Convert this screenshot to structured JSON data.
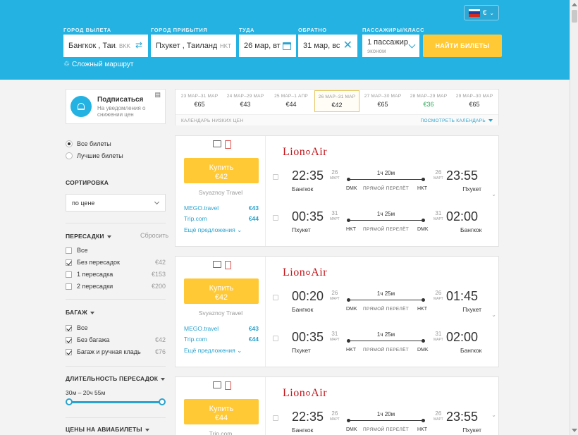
{
  "header": {
    "lang_currency": "€",
    "from_label": "ГОРОД ВЫЛЕТА",
    "from_value": "Бангкок , Таила",
    "from_code": "BKK",
    "to_label": "ГОРОД ПРИБЫТИЯ",
    "to_value": "Пхукет , Таиланд",
    "to_code": "HKT",
    "depart_label": "ТУДА",
    "depart_value": "26 мар, вт",
    "return_label": "ОБРАТНО",
    "return_value": "31 мар, вс",
    "pax_label": "ПАССАЖИРЫ/КЛАСС",
    "pax_value": "1 пассажир",
    "pax_class": "эконом",
    "search_button": "НАЙТИ БИЛЕТЫ",
    "complex_route": "Сложный маршрут"
  },
  "subscribe": {
    "title": "Подписаться",
    "desc": "На уведомления о снижении цен"
  },
  "date_strip": {
    "cells": [
      {
        "range": "23 МАР–31 МАР",
        "price": "€65"
      },
      {
        "range": "24 МАР–29 МАР",
        "price": "€43"
      },
      {
        "range": "25 МАР–1 АПР",
        "price": "€44"
      },
      {
        "range": "26 МАР–31 МАР",
        "price": "€42"
      },
      {
        "range": "27 МАР–30 МАР",
        "price": "€65"
      },
      {
        "range": "28 МАР–29 МАР",
        "price": "€36"
      },
      {
        "range": "29 МАР–30 МАР",
        "price": "€65"
      }
    ],
    "footer_left": "КАЛЕНДАРЬ НИЗКИХ ЦЕН",
    "footer_right": "ПОСМОТРЕТЬ КАЛЕНДАРЬ"
  },
  "filters": {
    "all_tickets": "Все билеты",
    "best_tickets": "Лучшие билеты",
    "sort_title": "СОРТИРОВКА",
    "sort_value": "по цене",
    "stops_title": "ПЕРЕСАДКИ",
    "reset": "Сбросить",
    "stops": [
      {
        "label": "Все",
        "price": ""
      },
      {
        "label": "Без пересадок",
        "price": "€42"
      },
      {
        "label": "1 пересадка",
        "price": "€153"
      },
      {
        "label": "2 пересадки",
        "price": "€200"
      }
    ],
    "baggage_title": "БАГАЖ",
    "baggage": [
      {
        "label": "Все",
        "price": ""
      },
      {
        "label": "Без багажа",
        "price": "€42"
      },
      {
        "label": "Багаж и ручная кладь",
        "price": "€76"
      }
    ],
    "duration_title": "ДЛИТЕЛЬНОСТЬ ПЕРЕСАДОК",
    "duration_range": "30м – 20ч 55м",
    "prices_title": "ЦЕНЫ НА АВИАБИЛЕТЫ"
  },
  "tickets": [
    {
      "buy": "Купить",
      "price": "€42",
      "agency": "Svyaznoy Travel",
      "offers": [
        {
          "name": "MEGO.travel",
          "price": "€43"
        },
        {
          "name": "Trip.com",
          "price": "€44"
        }
      ],
      "more": "Ещё предложения",
      "airline_a": "Lion",
      "airline_b": "Air",
      "segments": [
        {
          "dep_time": "22:35",
          "dep_day": "26",
          "dep_mon": "МАРТ",
          "dep_city": "Бангкок",
          "dep_code": "DMK",
          "duration": "1ч 20м",
          "direct": "ПРЯМОЙ ПЕРЕЛЁТ",
          "arr_code": "HKT",
          "arr_day": "26",
          "arr_mon": "МАРТ",
          "arr_time": "23:55",
          "arr_city": "Пхукет"
        },
        {
          "dep_time": "00:35",
          "dep_day": "31",
          "dep_mon": "МАРТ",
          "dep_city": "Пхукет",
          "dep_code": "HKT",
          "duration": "1ч 25м",
          "direct": "ПРЯМОЙ ПЕРЕЛЁТ",
          "arr_code": "DMK",
          "arr_day": "31",
          "arr_mon": "МАРТ",
          "arr_time": "02:00",
          "arr_city": "Бангкок"
        }
      ]
    },
    {
      "buy": "Купить",
      "price": "€42",
      "agency": "Svyaznoy Travel",
      "offers": [
        {
          "name": "MEGO.travel",
          "price": "€43"
        },
        {
          "name": "Trip.com",
          "price": "€44"
        }
      ],
      "more": "Ещё предложения",
      "airline_a": "Lion",
      "airline_b": "Air",
      "segments": [
        {
          "dep_time": "00:20",
          "dep_day": "26",
          "dep_mon": "МАРТ",
          "dep_city": "Бангкок",
          "dep_code": "DMK",
          "duration": "1ч 25м",
          "direct": "ПРЯМОЙ ПЕРЕЛЁТ",
          "arr_code": "HKT",
          "arr_day": "26",
          "arr_mon": "МАРТ",
          "arr_time": "01:45",
          "arr_city": "Пхукет"
        },
        {
          "dep_time": "00:35",
          "dep_day": "31",
          "dep_mon": "МАРТ",
          "dep_city": "Пхукет",
          "dep_code": "HKT",
          "duration": "1ч 25м",
          "direct": "ПРЯМОЙ ПЕРЕЛЁТ",
          "arr_code": "DMK",
          "arr_day": "31",
          "arr_mon": "МАРТ",
          "arr_time": "02:00",
          "arr_city": "Бангкок"
        }
      ]
    },
    {
      "buy": "Купить",
      "price": "€44",
      "agency": "Trip.com",
      "airline_a": "Lion",
      "airline_b": "Air",
      "segments": [
        {
          "dep_time": "22:35",
          "dep_day": "26",
          "dep_mon": "МАРТ",
          "dep_city": "Бангкок",
          "dep_code": "DMK",
          "duration": "1ч 20м",
          "direct": "ПРЯМОЙ ПЕРЕЛЁТ",
          "arr_code": "HKT",
          "arr_day": "26",
          "arr_mon": "МАРТ",
          "arr_time": "23:55",
          "arr_city": "Пхукет"
        }
      ]
    }
  ]
}
